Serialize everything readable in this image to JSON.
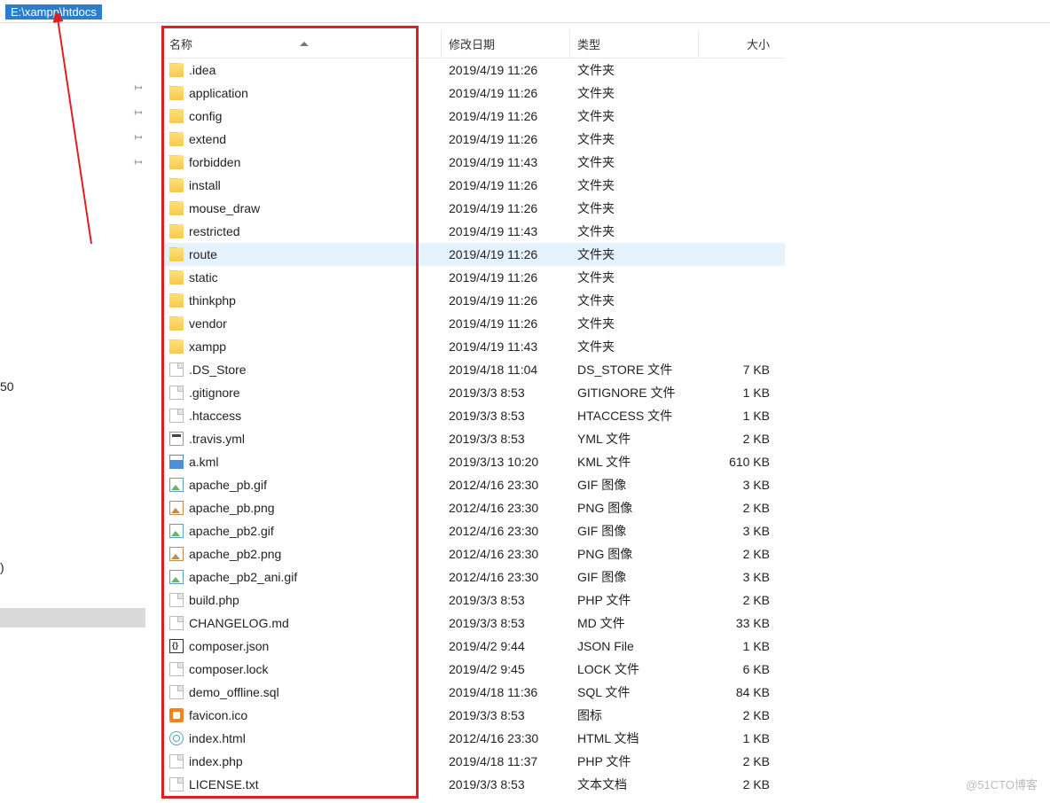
{
  "address_path": "E:\\xampp\\htdocs",
  "left_fragment_1": "50",
  "left_fragment_2": ")",
  "watermark": "@51CTO博客",
  "columns": {
    "name": "名称",
    "date": "修改日期",
    "type": "类型",
    "size": "大小"
  },
  "files": [
    {
      "icon": "folder",
      "name": ".idea",
      "date": "2019/4/19 11:26",
      "type": "文件夹",
      "size": ""
    },
    {
      "icon": "folder",
      "name": "application",
      "date": "2019/4/19 11:26",
      "type": "文件夹",
      "size": ""
    },
    {
      "icon": "folder",
      "name": "config",
      "date": "2019/4/19 11:26",
      "type": "文件夹",
      "size": ""
    },
    {
      "icon": "folder",
      "name": "extend",
      "date": "2019/4/19 11:26",
      "type": "文件夹",
      "size": ""
    },
    {
      "icon": "folder",
      "name": "forbidden",
      "date": "2019/4/19 11:43",
      "type": "文件夹",
      "size": ""
    },
    {
      "icon": "folder",
      "name": "install",
      "date": "2019/4/19 11:26",
      "type": "文件夹",
      "size": ""
    },
    {
      "icon": "folder",
      "name": "mouse_draw",
      "date": "2019/4/19 11:26",
      "type": "文件夹",
      "size": ""
    },
    {
      "icon": "folder",
      "name": "restricted",
      "date": "2019/4/19 11:43",
      "type": "文件夹",
      "size": ""
    },
    {
      "icon": "folder",
      "name": "route",
      "date": "2019/4/19 11:26",
      "type": "文件夹",
      "size": "",
      "hover": true
    },
    {
      "icon": "folder",
      "name": "static",
      "date": "2019/4/19 11:26",
      "type": "文件夹",
      "size": ""
    },
    {
      "icon": "folder",
      "name": "thinkphp",
      "date": "2019/4/19 11:26",
      "type": "文件夹",
      "size": ""
    },
    {
      "icon": "folder",
      "name": "vendor",
      "date": "2019/4/19 11:26",
      "type": "文件夹",
      "size": ""
    },
    {
      "icon": "folder",
      "name": "xampp",
      "date": "2019/4/19 11:43",
      "type": "文件夹",
      "size": ""
    },
    {
      "icon": "file",
      "name": ".DS_Store",
      "date": "2019/4/18 11:04",
      "type": "DS_STORE 文件",
      "size": "7 KB"
    },
    {
      "icon": "file",
      "name": ".gitignore",
      "date": "2019/3/3 8:53",
      "type": "GITIGNORE 文件",
      "size": "1 KB"
    },
    {
      "icon": "file",
      "name": ".htaccess",
      "date": "2019/3/3 8:53",
      "type": "HTACCESS 文件",
      "size": "1 KB"
    },
    {
      "icon": "yml",
      "name": ".travis.yml",
      "date": "2019/3/3 8:53",
      "type": "YML 文件",
      "size": "2 KB"
    },
    {
      "icon": "kml",
      "name": "a.kml",
      "date": "2019/3/13 10:20",
      "type": "KML 文件",
      "size": "610 KB"
    },
    {
      "icon": "img",
      "name": "apache_pb.gif",
      "date": "2012/4/16 23:30",
      "type": "GIF 图像",
      "size": "3 KB"
    },
    {
      "icon": "png",
      "name": "apache_pb.png",
      "date": "2012/4/16 23:30",
      "type": "PNG 图像",
      "size": "2 KB"
    },
    {
      "icon": "img",
      "name": "apache_pb2.gif",
      "date": "2012/4/16 23:30",
      "type": "GIF 图像",
      "size": "3 KB"
    },
    {
      "icon": "png",
      "name": "apache_pb2.png",
      "date": "2012/4/16 23:30",
      "type": "PNG 图像",
      "size": "2 KB"
    },
    {
      "icon": "img",
      "name": "apache_pb2_ani.gif",
      "date": "2012/4/16 23:30",
      "type": "GIF 图像",
      "size": "3 KB"
    },
    {
      "icon": "file",
      "name": "build.php",
      "date": "2019/3/3 8:53",
      "type": "PHP 文件",
      "size": "2 KB"
    },
    {
      "icon": "file",
      "name": "CHANGELOG.md",
      "date": "2019/3/3 8:53",
      "type": "MD 文件",
      "size": "33 KB"
    },
    {
      "icon": "json",
      "name": "composer.json",
      "date": "2019/4/2 9:44",
      "type": "JSON File",
      "size": "1 KB"
    },
    {
      "icon": "file",
      "name": "composer.lock",
      "date": "2019/4/2 9:45",
      "type": "LOCK 文件",
      "size": "6 KB"
    },
    {
      "icon": "file",
      "name": "demo_offline.sql",
      "date": "2019/4/18 11:36",
      "type": "SQL 文件",
      "size": "84 KB"
    },
    {
      "icon": "favicon",
      "name": "favicon.ico",
      "date": "2019/3/3 8:53",
      "type": "图标",
      "size": "2 KB"
    },
    {
      "icon": "html",
      "name": "index.html",
      "date": "2012/4/16 23:30",
      "type": "HTML 文档",
      "size": "1 KB"
    },
    {
      "icon": "file",
      "name": "index.php",
      "date": "2019/4/18 11:37",
      "type": "PHP 文件",
      "size": "2 KB"
    },
    {
      "icon": "file",
      "name": "LICENSE.txt",
      "date": "2019/3/3 8:53",
      "type": "文本文档",
      "size": "2 KB"
    }
  ]
}
